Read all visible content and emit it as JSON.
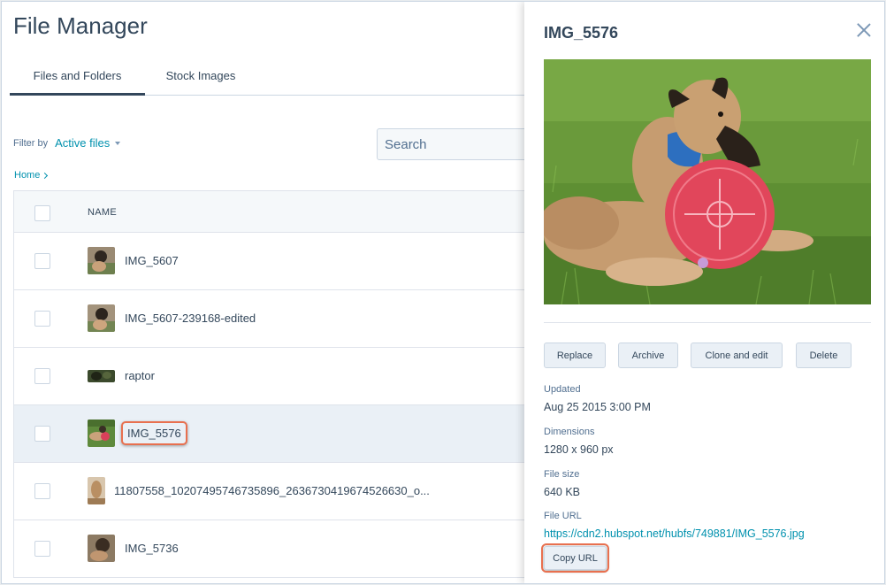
{
  "page": {
    "title": "File Manager"
  },
  "tabs": [
    {
      "label": "Files and Folders",
      "active": true
    },
    {
      "label": "Stock Images",
      "active": false
    }
  ],
  "filter": {
    "label": "Filter by",
    "value": "Active files"
  },
  "search": {
    "placeholder": "Search"
  },
  "breadcrumb": {
    "home": "Home"
  },
  "table": {
    "header": "NAME",
    "rows": [
      {
        "name": "IMG_5607"
      },
      {
        "name": "IMG_5607-239168-edited"
      },
      {
        "name": "raptor"
      },
      {
        "name": "IMG_5576",
        "selected": true
      },
      {
        "name": "11807558_10207495746735896_2636730419674526630_o..."
      },
      {
        "name": "IMG_5736"
      }
    ]
  },
  "panel": {
    "title": "IMG_5576",
    "buttons": {
      "replace": "Replace",
      "archive": "Archive",
      "clone": "Clone and edit",
      "delete": "Delete"
    },
    "updated_label": "Updated",
    "updated_value": "Aug 25 2015 3:00 PM",
    "dimensions_label": "Dimensions",
    "dimensions_value": "1280 x 960 px",
    "filesize_label": "File size",
    "filesize_value": "640 KB",
    "fileurl_label": "File URL",
    "fileurl_value": "https://cdn2.hubspot.net/hubfs/749881/IMG_5576.jpg",
    "copy_label": "Copy URL"
  },
  "colors": {
    "accent": "#0091ae",
    "highlight": "#e8704f",
    "text": "#33475b",
    "selected_row": "#eaf0f6"
  }
}
